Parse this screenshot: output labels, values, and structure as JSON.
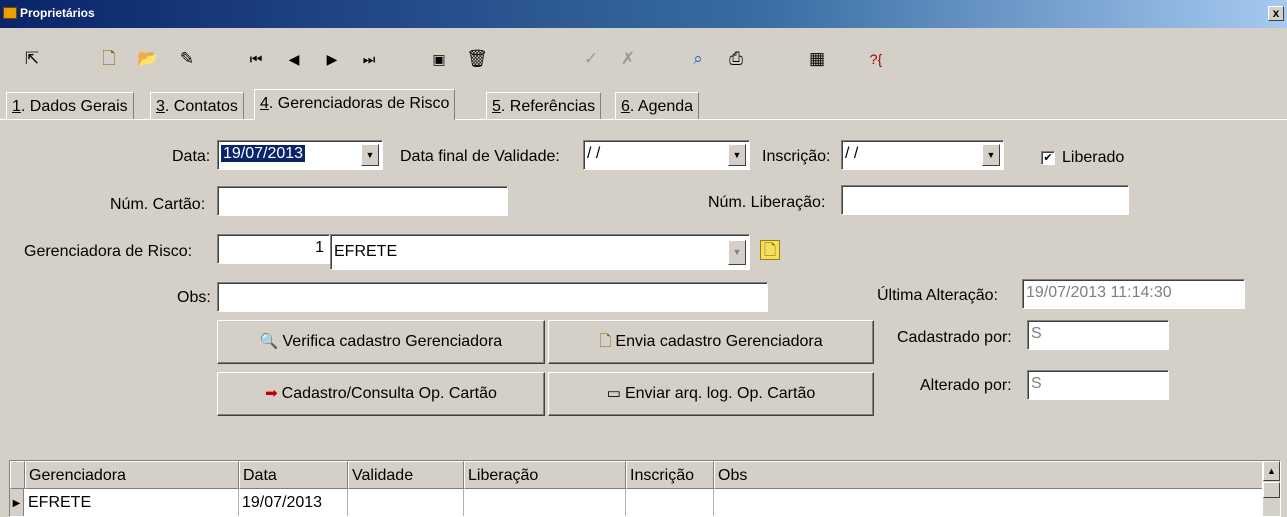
{
  "window": {
    "title": "Proprietários",
    "close": "x"
  },
  "toolbar": {
    "icons": [
      "exit-icon",
      "new-icon",
      "open-icon",
      "edit-icon",
      "first-record-icon",
      "previous-record-icon",
      "next-record-icon",
      "last-record-icon",
      "find-icon",
      "delete-icon",
      "confirm-icon",
      "cancel-icon",
      "search-icon",
      "print-icon",
      "calculator-icon",
      "help-icon"
    ]
  },
  "tabs": [
    {
      "key": "1",
      "label": ". Dados Gerais"
    },
    {
      "key": "3",
      "label": ". Contatos"
    },
    {
      "key": "4",
      "label": ". Gerenciadoras de Risco"
    },
    {
      "key": "5",
      "label": ". Referências"
    },
    {
      "key": "6",
      "label": ". Agenda"
    }
  ],
  "form": {
    "data_label": "Data:",
    "data_value": "19/07/2013",
    "data_final_label": "Data final de Validade:",
    "data_final_value": "/ /",
    "inscricao_label": "Inscrição:",
    "inscricao_value": "/ /",
    "liberado_label": "Liberado",
    "liberado_checked": true,
    "num_cartao_label": "Núm. Cartão:",
    "num_cartao_value": "",
    "num_liberacao_label": "Núm. Liberação:",
    "num_liberacao_value": "",
    "gerenciadora_label": "Gerenciadora de Risco:",
    "gerenciadora_code": "1",
    "gerenciadora_name": "EFRETE",
    "obs_label": "Obs:",
    "obs_value": "",
    "ultima_alteracao_label": "Última Alteração:",
    "ultima_alteracao_value": "19/07/2013 11:14:30",
    "cadastrado_por_label": "Cadastrado por:",
    "cadastrado_por_value": "S",
    "alterado_por_label": "Alterado por:",
    "alterado_por_value": "S"
  },
  "buttons": {
    "verifica": "Verifica cadastro Gerenciadora",
    "envia": "Envia cadastro Gerenciadora",
    "cadastro_consulta": "Cadastro/Consulta Op. Cartão",
    "enviar_arq": "Enviar arq. log. Op. Cartão"
  },
  "grid": {
    "columns": [
      "Gerenciadora",
      "Data",
      "Validade",
      "Liberação",
      "Inscrição",
      "Obs"
    ],
    "rows": [
      [
        "EFRETE",
        "19/07/2013",
        "",
        "",
        "",
        ""
      ]
    ]
  }
}
